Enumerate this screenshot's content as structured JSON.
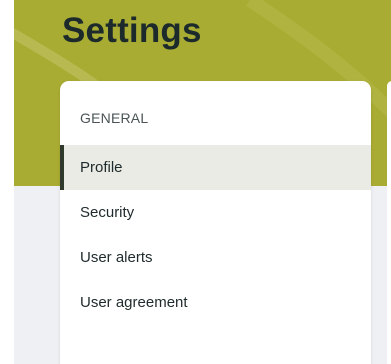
{
  "page": {
    "title": "Settings"
  },
  "nav": {
    "section_heading": "GENERAL",
    "items": [
      {
        "label": "Profile",
        "active": true
      },
      {
        "label": "Security",
        "active": false
      },
      {
        "label": "User alerts",
        "active": false
      },
      {
        "label": "User agreement",
        "active": false
      }
    ]
  },
  "colors": {
    "header_band": "#a9ac33",
    "active_item_bg": "#e9ebe4",
    "active_indicator": "#2f3a2c",
    "page_background": "#eef0f3"
  }
}
